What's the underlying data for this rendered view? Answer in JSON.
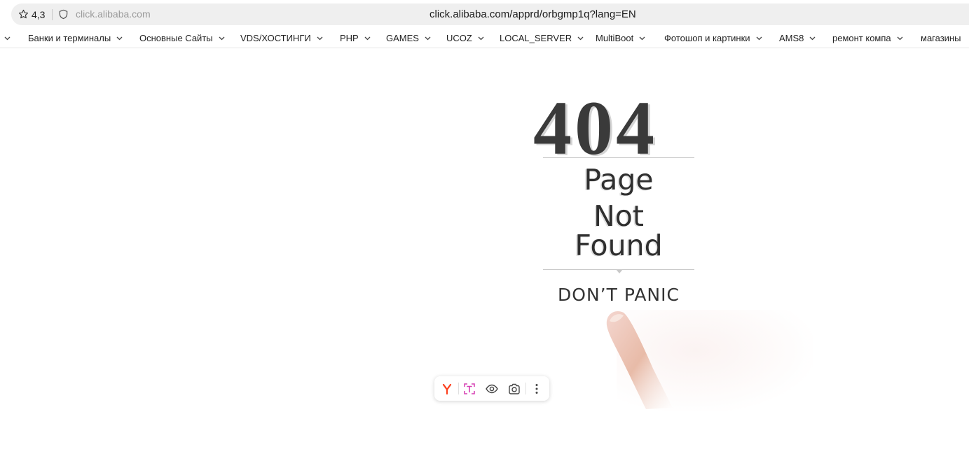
{
  "addressbar": {
    "rating": "4,3",
    "host": "click.alibaba.com",
    "url": "click.alibaba.com/apprd/orbgmp1q?lang=EN"
  },
  "bookmarks": {
    "items": [
      {
        "label": "Банки и терминалы"
      },
      {
        "label": "Основные Сайты"
      },
      {
        "label": "VDS/ХОСТИНГИ"
      },
      {
        "label": "PHP"
      },
      {
        "label": "GAMES"
      },
      {
        "label": "UCOZ"
      },
      {
        "label": "LOCAL_SERVER"
      },
      {
        "label": "MultiBoot"
      },
      {
        "label": "Фотошоп и картинки"
      },
      {
        "label": "AMS8"
      },
      {
        "label": "ремонт компа"
      },
      {
        "label": "магазины"
      }
    ]
  },
  "page": {
    "code": "404",
    "line1": "Page",
    "line2": "Not",
    "line3": "Found",
    "tagline": "DON’T PANIC"
  },
  "toolbar": {
    "icons": [
      "yandex-icon",
      "text-recognition-icon",
      "eye-icon",
      "screenshot-icon",
      "more-icon"
    ]
  },
  "colors": {
    "addressbar_bg": "#efefef",
    "yandex_red": "#fc3f1d",
    "text_tool_pink": "#d63fb4"
  }
}
